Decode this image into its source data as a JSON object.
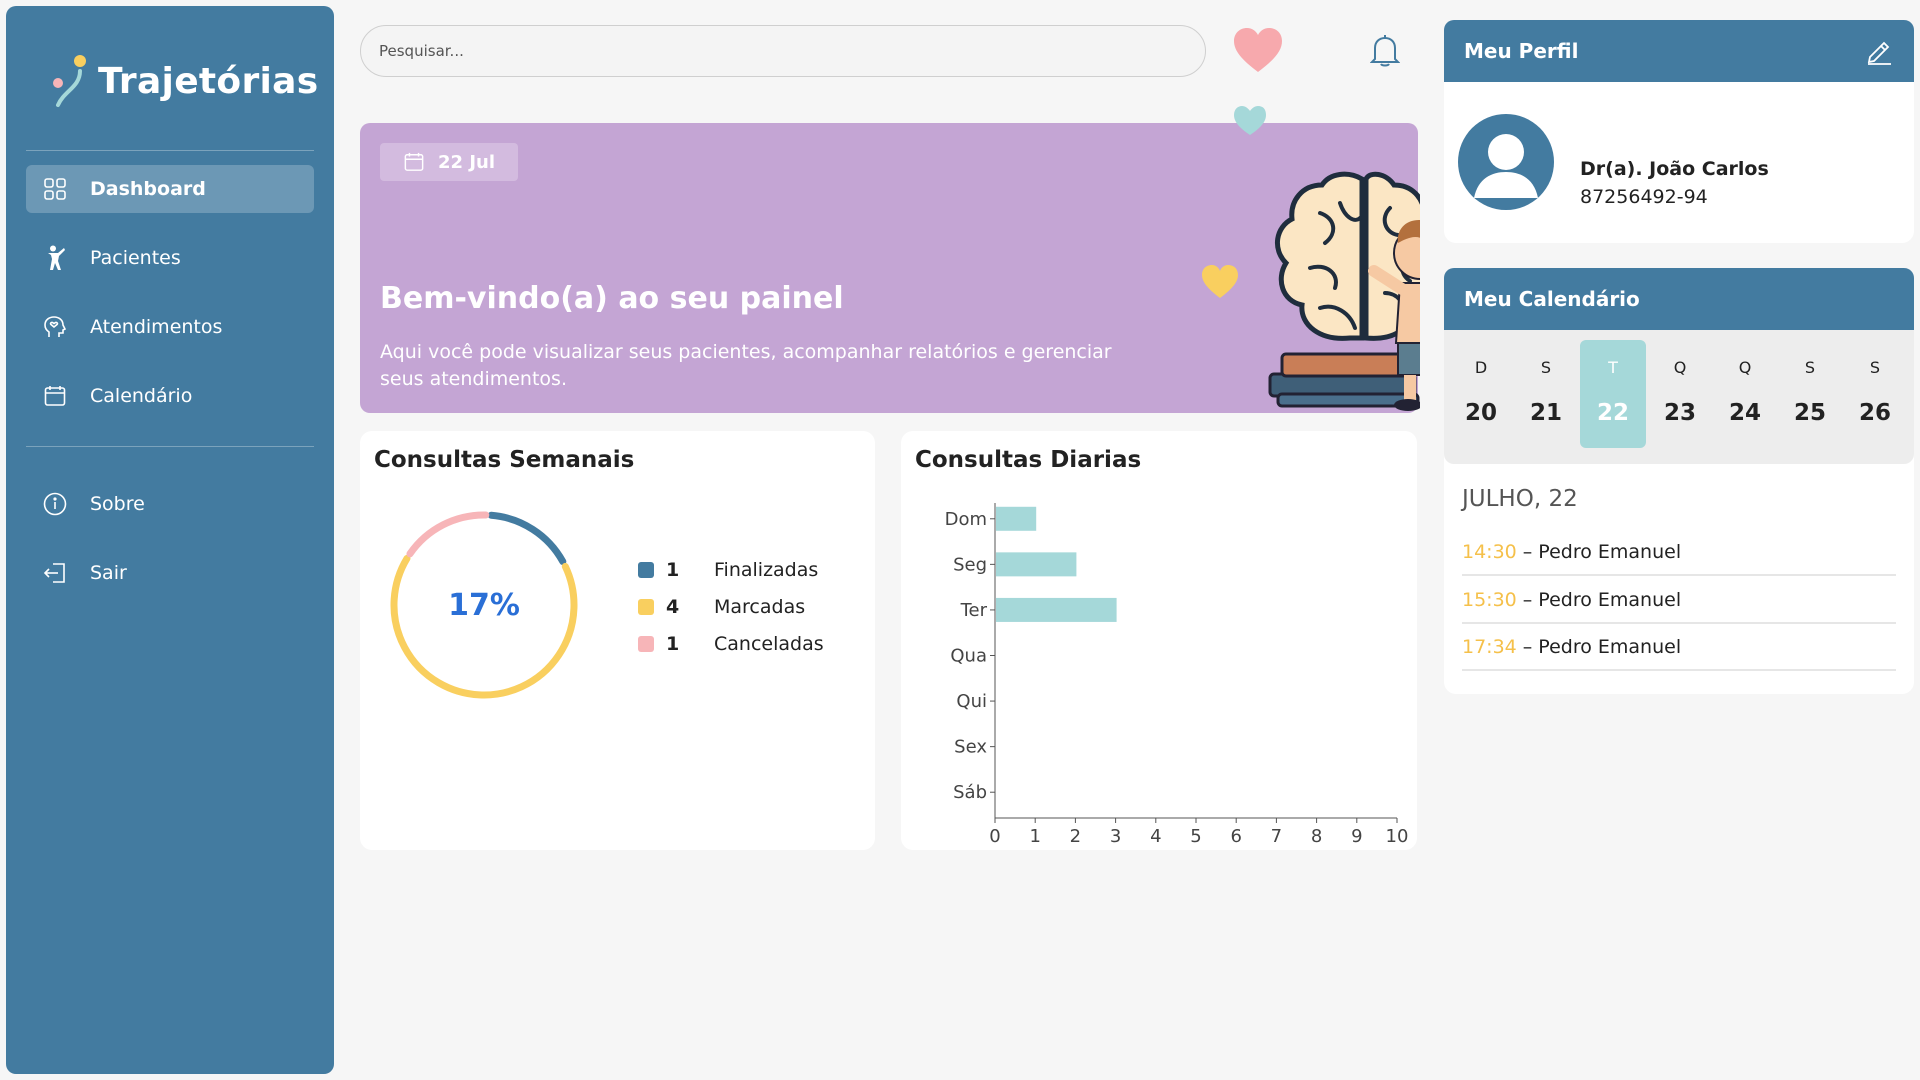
{
  "sidebar": {
    "logo": "Trajetórias",
    "items": [
      {
        "label": "Dashboard",
        "icon": "grid-icon",
        "active": true
      },
      {
        "label": "Pacientes",
        "icon": "person-icon"
      },
      {
        "label": "Atendimentos",
        "icon": "head-heart-icon"
      },
      {
        "label": "Calendário",
        "icon": "calendar-icon"
      },
      {
        "label": "Sobre",
        "icon": "info-icon"
      },
      {
        "label": "Sair",
        "icon": "logout-icon"
      }
    ]
  },
  "header": {
    "search_placeholder": "Pesquisar...",
    "icons": [
      "heart-icon",
      "bell-icon"
    ]
  },
  "banner": {
    "date": "22 Jul",
    "title": "Bem-vindo(a) ao seu painel",
    "subtitle": "Aqui você pode visualizar seus pacientes, acompanhar relatórios e gerenciar seus atendimentos."
  },
  "weekly": {
    "title": "Consultas Semanais",
    "percent": "17%",
    "legend": [
      {
        "value": "1",
        "label": "Finalizadas",
        "color": "#437ba0"
      },
      {
        "value": "4",
        "label": "Marcadas",
        "color": "#f9cf5f"
      },
      {
        "value": "1",
        "label": "Canceladas",
        "color": "#f7b5b8"
      }
    ]
  },
  "daily": {
    "title": "Consultas Diarias"
  },
  "chart_data": [
    {
      "type": "pie",
      "title": "Consultas Semanais",
      "categories": [
        "Finalizadas",
        "Marcadas",
        "Canceladas"
      ],
      "values": [
        1,
        4,
        1
      ],
      "center_label": "17%",
      "colors": [
        "#437ba0",
        "#f9cf5f",
        "#f7b5b8"
      ]
    },
    {
      "type": "bar",
      "orientation": "horizontal",
      "title": "Consultas Diarias",
      "categories": [
        "Dom",
        "Seg",
        "Ter",
        "Qua",
        "Qui",
        "Sex",
        "Sáb"
      ],
      "values": [
        1,
        2,
        3,
        0,
        0,
        0,
        0
      ],
      "xlim": [
        0,
        10
      ],
      "xticks": [
        "0",
        "1",
        "2",
        "3",
        "4",
        "5",
        "6",
        "7",
        "8",
        "9",
        "10"
      ],
      "color": "#a5d8d9"
    }
  ],
  "profile": {
    "title": "Meu Perfil",
    "name": "Dr(a). João Carlos",
    "id": "87256492-94"
  },
  "calendar": {
    "title": "Meu Calendário",
    "days": [
      {
        "letter": "D",
        "num": "20"
      },
      {
        "letter": "S",
        "num": "21"
      },
      {
        "letter": "T",
        "num": "22",
        "selected": true
      },
      {
        "letter": "Q",
        "num": "23"
      },
      {
        "letter": "Q",
        "num": "24"
      },
      {
        "letter": "S",
        "num": "25"
      },
      {
        "letter": "S",
        "num": "26"
      }
    ],
    "date_label": "JULHO, 22",
    "appointments": [
      {
        "time": "14:30",
        "text": "– Pedro Emanuel"
      },
      {
        "time": "15:30",
        "text": "– Pedro Emanuel"
      },
      {
        "time": "17:34",
        "text": "– Pedro Emanuel"
      }
    ]
  },
  "colors": {
    "sidebar": "#437ba0",
    "banner": "#c4a5d4",
    "accent_teal": "#a5d8d9",
    "accent_yellow": "#f9cf5f",
    "accent_pink": "#f7b5b8"
  }
}
